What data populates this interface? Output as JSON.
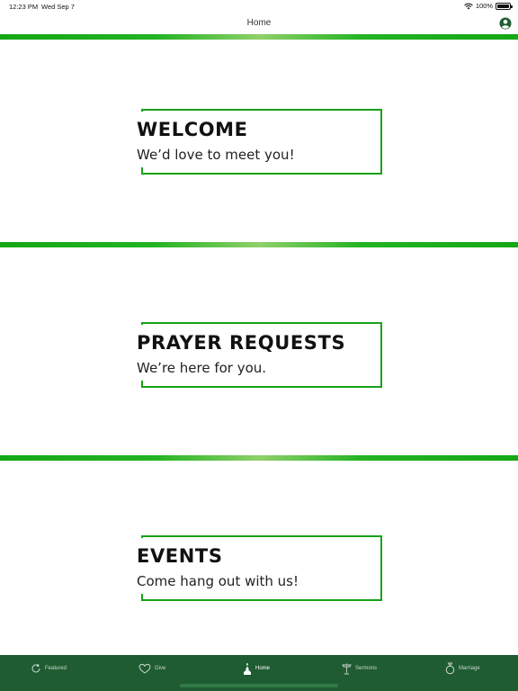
{
  "status_bar": {
    "time": "12:23 PM",
    "date": "Wed Sep 7",
    "battery": "100%"
  },
  "nav": {
    "title": "Home",
    "profile_icon": "person-circle-icon"
  },
  "colors": {
    "accent": "#17a217",
    "tab_bar": "#1f5c32"
  },
  "cards": [
    {
      "title": "WELCOME",
      "subtitle": "We’d love to meet you!"
    },
    {
      "title": "PRAYER REQUESTS",
      "subtitle": "We’re here for you."
    },
    {
      "title": "EVENTS",
      "subtitle": "Come hang out with us!"
    }
  ],
  "tabs": [
    {
      "label": "Featured",
      "icon": "refresh-icon",
      "active": false
    },
    {
      "label": "Give",
      "icon": "heart-icon",
      "active": false
    },
    {
      "label": "Home",
      "icon": "church-icon",
      "active": true
    },
    {
      "label": "Sermons",
      "icon": "pulpit-icon",
      "active": false
    },
    {
      "label": "Marriage",
      "icon": "ring-icon",
      "active": false
    }
  ]
}
